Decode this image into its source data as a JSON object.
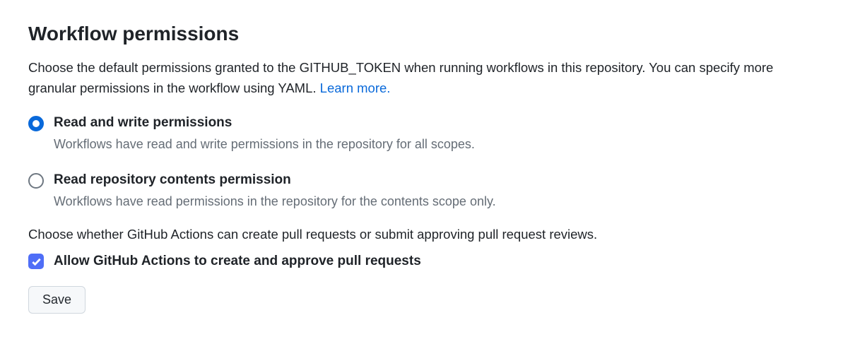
{
  "heading": "Workflow permissions",
  "description_text": "Choose the default permissions granted to the GITHUB_TOKEN when running workflows in this repository. You can specify more granular permissions in the workflow using YAML. ",
  "learn_more": "Learn more.",
  "options": {
    "read_write": {
      "title": "Read and write permissions",
      "desc": "Workflows have read and write permissions in the repository for all scopes."
    },
    "read_only": {
      "title": "Read repository contents permission",
      "desc": "Workflows have read permissions in the repository for the contents scope only."
    }
  },
  "pr_description": "Choose whether GitHub Actions can create pull requests or submit approving pull request reviews.",
  "allow_pr_label": "Allow GitHub Actions to create and approve pull requests",
  "save_label": "Save"
}
